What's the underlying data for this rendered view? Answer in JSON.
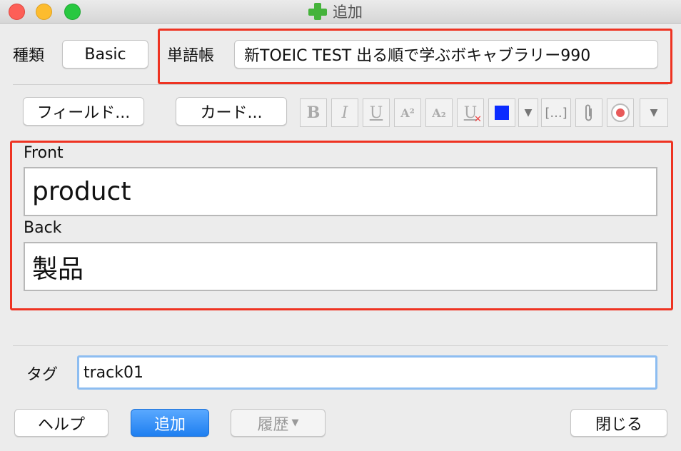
{
  "window": {
    "title": "追加",
    "icon": "plus-icon"
  },
  "top": {
    "type_label": "種類",
    "type_value": "Basic",
    "deck_label": "単語帳",
    "deck_value": "新TOEIC TEST 出る順で学ぶボキャブラリー990"
  },
  "toolbar": {
    "fields_button": "フィールド...",
    "cards_button": "カード...",
    "bold": "B",
    "italic": "I",
    "underline": "U",
    "superscript": "A²",
    "subscript": "A₂",
    "clear_format": "U",
    "cloze": "[...]",
    "text_color": "#0a2bff"
  },
  "fields": [
    {
      "label": "Front",
      "value": "product"
    },
    {
      "label": "Back",
      "value": "製品"
    }
  ],
  "tags": {
    "label": "タグ",
    "value": "track01"
  },
  "bottom": {
    "help": "ヘルプ",
    "add": "追加",
    "history": "履歴",
    "close": "閉じる"
  },
  "colors": {
    "annotation_red": "#ee3322",
    "accent_blue": "#1f8bf3",
    "add_icon_green": "#45b33b"
  }
}
